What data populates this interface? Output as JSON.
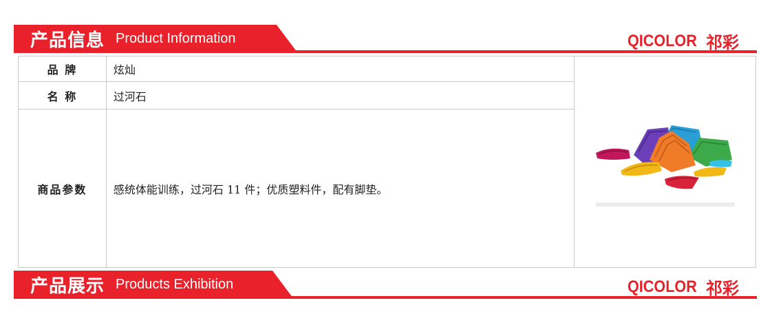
{
  "section_info": {
    "title_zh": "产品信息",
    "title_en": "Product Information",
    "logo_text": "QICOLOR",
    "logo_mark": "祁彩"
  },
  "table": {
    "brand_label": "品  牌",
    "brand_value": "炫灿",
    "name_label": "名  称",
    "name_value": "过河石",
    "params_label": "商品参数",
    "params_value": "感统体能训练，过河石 11 件；优质塑料件，配有脚垫。"
  },
  "section_exhibition": {
    "title_zh": "产品展示",
    "title_en": "Products Exhibition",
    "logo_text": "QICOLOR",
    "logo_mark": "祁彩"
  },
  "colors": {
    "accent": "#e8212b",
    "border": "#c9c9c9"
  }
}
